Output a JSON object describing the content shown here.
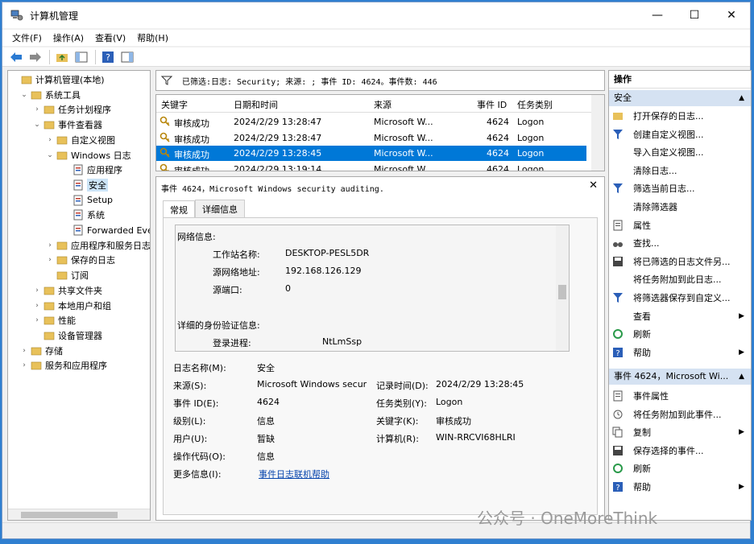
{
  "window": {
    "title": "计算机管理",
    "minimize": "—",
    "maximize": "☐",
    "close": "✕"
  },
  "menu": [
    "文件(F)",
    "操作(A)",
    "查看(V)",
    "帮助(H)"
  ],
  "tree": [
    {
      "label": "计算机管理(本地)",
      "level": 0,
      "arrow": ""
    },
    {
      "label": "系统工具",
      "level": 1,
      "arrow": "⌄"
    },
    {
      "label": "任务计划程序",
      "level": 2,
      "arrow": "›"
    },
    {
      "label": "事件查看器",
      "level": 2,
      "arrow": "⌄"
    },
    {
      "label": "自定义视图",
      "level": 3,
      "arrow": "›"
    },
    {
      "label": "Windows 日志",
      "level": 3,
      "arrow": "⌄"
    },
    {
      "label": "应用程序",
      "level": 4,
      "arrow": ""
    },
    {
      "label": "安全",
      "level": 4,
      "arrow": "",
      "selected": true
    },
    {
      "label": "Setup",
      "level": 4,
      "arrow": ""
    },
    {
      "label": "系统",
      "level": 4,
      "arrow": ""
    },
    {
      "label": "Forwarded Eve",
      "level": 4,
      "arrow": ""
    },
    {
      "label": "应用程序和服务日志",
      "level": 3,
      "arrow": "›"
    },
    {
      "label": "保存的日志",
      "level": 3,
      "arrow": "›"
    },
    {
      "label": "订阅",
      "level": 3,
      "arrow": ""
    },
    {
      "label": "共享文件夹",
      "level": 2,
      "arrow": "›"
    },
    {
      "label": "本地用户和组",
      "level": 2,
      "arrow": "›"
    },
    {
      "label": "性能",
      "level": 2,
      "arrow": "›"
    },
    {
      "label": "设备管理器",
      "level": 2,
      "arrow": ""
    },
    {
      "label": "存储",
      "level": 1,
      "arrow": "›"
    },
    {
      "label": "服务和应用程序",
      "level": 1,
      "arrow": "›"
    }
  ],
  "filter": {
    "text": "已筛选:日志: Security; 来源: ; 事件 ID: 4624。事件数: 446"
  },
  "grid": {
    "headers": [
      "关键字",
      "日期和时间",
      "来源",
      "事件 ID",
      "任务类别"
    ],
    "rows": [
      [
        "审核成功",
        "2024/2/29 13:28:47",
        "Microsoft W...",
        "4624",
        "Logon"
      ],
      [
        "审核成功",
        "2024/2/29 13:28:47",
        "Microsoft W...",
        "4624",
        "Logon"
      ],
      [
        "审核成功",
        "2024/2/29 13:28:45",
        "Microsoft W...",
        "4624",
        "Logon"
      ],
      [
        "审核成功",
        "2024/2/29 13:19:14",
        "Microsoft W...",
        "4624",
        "Logon"
      ]
    ],
    "selected_index": 2
  },
  "detail": {
    "header": "事件 4624，Microsoft Windows security auditing.",
    "close": "✕",
    "tabs": [
      "常规",
      "详细信息"
    ],
    "inner": {
      "network_title": "网络信息:",
      "workstation_label": "工作站名称:",
      "workstation_value": "DESKTOP-PESL5DR",
      "srcaddr_label": "源网络地址:",
      "srcaddr_value": "192.168.126.129",
      "srcport_label": "源端口:",
      "srcport_value": "0",
      "auth_title": "详细的身份验证信息:",
      "logon_proc_label": "登录进程:",
      "logon_proc_value": "NtLmSsp"
    },
    "fields": {
      "logname_label": "日志名称(M):",
      "logname_value": "安全",
      "source_label": "来源(S):",
      "source_value": "Microsoft Windows secur",
      "recorded_label": "记录时间(D):",
      "recorded_value": "2024/2/29 13:28:45",
      "eventid_label": "事件 ID(E):",
      "eventid_value": "4624",
      "category_label": "任务类别(Y):",
      "category_value": "Logon",
      "level_label": "级别(L):",
      "level_value": "信息",
      "keyword_label": "关键字(K):",
      "keyword_value": "审核成功",
      "user_label": "用户(U):",
      "user_value": "暂缺",
      "computer_label": "计算机(R):",
      "computer_value": "WIN-RRCVI68HLRI",
      "opcode_label": "操作代码(O):",
      "opcode_value": "信息",
      "moreinfo_label": "更多信息(I):",
      "moreinfo_link": "事件日志联机帮助"
    }
  },
  "actions": {
    "title": "操作",
    "section1": "安全",
    "items1": [
      {
        "label": "打开保存的日志...",
        "icon": "folder-open-icon",
        "sub": false
      },
      {
        "label": "创建自定义视图...",
        "icon": "filter-icon",
        "sub": false
      },
      {
        "label": "导入自定义视图...",
        "icon": "",
        "sub": false
      },
      {
        "label": "清除日志...",
        "icon": "",
        "sub": false
      },
      {
        "label": "筛选当前日志...",
        "icon": "filter-icon",
        "sub": false
      },
      {
        "label": "清除筛选器",
        "icon": "",
        "sub": false
      },
      {
        "label": "属性",
        "icon": "properties-icon",
        "sub": false
      },
      {
        "label": "查找...",
        "icon": "binoculars-icon",
        "sub": false
      },
      {
        "label": "将已筛选的日志文件另...",
        "icon": "save-icon",
        "sub": false
      },
      {
        "label": "将任务附加到此日志...",
        "icon": "",
        "sub": false
      },
      {
        "label": "将筛选器保存到自定义...",
        "icon": "filter-save-icon",
        "sub": false
      },
      {
        "label": "查看",
        "icon": "",
        "sub": true
      },
      {
        "label": "刷新",
        "icon": "refresh-icon",
        "sub": false
      },
      {
        "label": "帮助",
        "icon": "help-icon",
        "sub": true
      }
    ],
    "section2": "事件 4624，Microsoft Wi...",
    "items2": [
      {
        "label": "事件属性",
        "icon": "properties-icon",
        "sub": false
      },
      {
        "label": "将任务附加到此事件...",
        "icon": "task-icon",
        "sub": false
      },
      {
        "label": "复制",
        "icon": "copy-icon",
        "sub": true
      },
      {
        "label": "保存选择的事件...",
        "icon": "save-icon",
        "sub": false
      },
      {
        "label": "刷新",
        "icon": "refresh-icon",
        "sub": false
      },
      {
        "label": "帮助",
        "icon": "help-icon",
        "sub": true
      }
    ]
  },
  "watermark": "公众号 · OneMoreThink",
  "colors": {
    "selection": "#0078d7",
    "section_bg": "#d5e2f2",
    "link": "#0645ad"
  }
}
